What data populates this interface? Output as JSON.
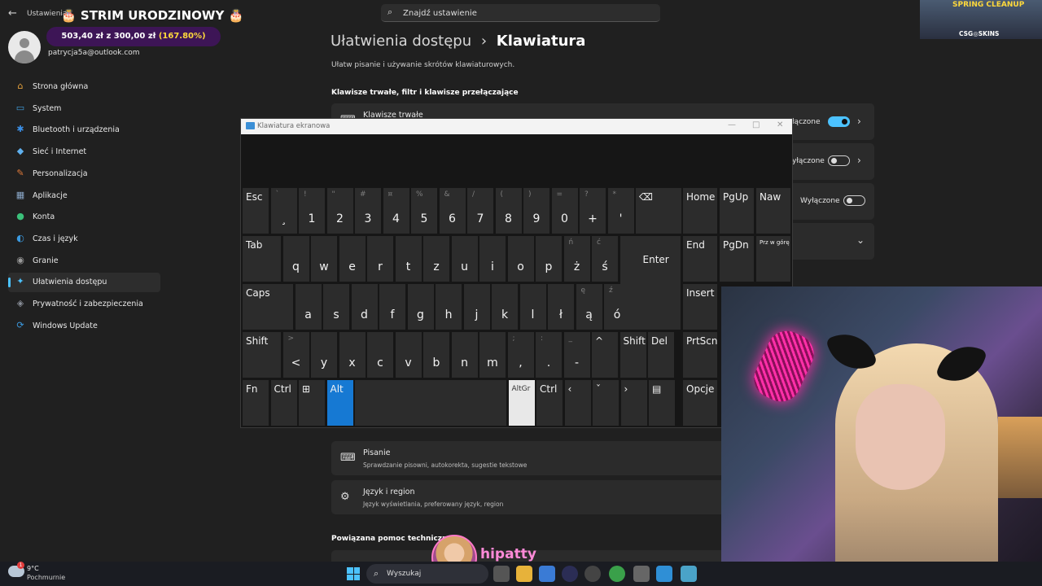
{
  "app": {
    "title": "Ustawienia",
    "back_glyph": "←"
  },
  "search": {
    "placeholder": "Znajdź ustawienie",
    "icon": "search-icon"
  },
  "account": {
    "email": "patrycja5a@outlook.com"
  },
  "stream_overlay": {
    "title": "🎂 STRIM URODZINOWY 🎂",
    "goal_text": "503,40 zł z 300,00 zł",
    "goal_percent": "(167.80%)",
    "banner_title": "SPRING CLEANUP",
    "banner_sub": "CSG◎SKINS",
    "streamer_name": "hipatty"
  },
  "sidebar": {
    "items": [
      {
        "label": "Strona główna",
        "icon": "home-icon",
        "glyph": "⌂",
        "color": "#e8a33c"
      },
      {
        "label": "System",
        "icon": "system-icon",
        "glyph": "▭",
        "color": "#3fa0e0"
      },
      {
        "label": "Bluetooth i urządzenia",
        "icon": "bluetooth-icon",
        "glyph": "✱",
        "color": "#3b8fe6"
      },
      {
        "label": "Sieć i Internet",
        "icon": "network-icon",
        "glyph": "◆",
        "color": "#5fb0ee"
      },
      {
        "label": "Personalizacja",
        "icon": "brush-icon",
        "glyph": "✎",
        "color": "#e07a3a"
      },
      {
        "label": "Aplikacje",
        "icon": "apps-icon",
        "glyph": "▦",
        "color": "#8aa7c8"
      },
      {
        "label": "Konta",
        "icon": "account-icon",
        "glyph": "●",
        "color": "#3bc07a"
      },
      {
        "label": "Czas i język",
        "icon": "globe-icon",
        "glyph": "◐",
        "color": "#3b9ae0"
      },
      {
        "label": "Granie",
        "icon": "gaming-icon",
        "glyph": "◉",
        "color": "#9a9a9a"
      },
      {
        "label": "Ułatwienia dostępu",
        "icon": "accessibility-icon",
        "glyph": "✦",
        "color": "#4cc2ff",
        "active": true
      },
      {
        "label": "Prywatność i zabezpieczenia",
        "icon": "shield-icon",
        "glyph": "◈",
        "color": "#8a8f99"
      },
      {
        "label": "Windows Update",
        "icon": "update-icon",
        "glyph": "⟳",
        "color": "#3b9ae0"
      }
    ]
  },
  "main": {
    "breadcrumb_parent": "Ułatwienia dostępu",
    "breadcrumb_sep": "›",
    "breadcrumb_current": "Klawiatura",
    "subtitle": "Ułatw pisanie i używanie skrótów klawiaturowych.",
    "section_title": "Klawisze trwałe, filtr i klawisze przełączające",
    "sticky_keys_label": "Klawisze trwałe",
    "toggle_rows": [
      {
        "state": "łączone",
        "on": true
      },
      {
        "state": "yłączone",
        "on": false
      },
      {
        "state": "Wyłączone",
        "on": false
      }
    ],
    "cards": [
      {
        "title": "Pisanie",
        "desc": "Sprawdzanie pisowni, autokorekta, sugestie tekstowe",
        "icon": "keyboard-icon"
      },
      {
        "title": "Język i region",
        "desc": "Język wyświetlania, preferowany język, region",
        "icon": "language-icon"
      }
    ],
    "related_title": "Powiązana pomoc techniczna"
  },
  "osk": {
    "title": "Klawiatura ekranowa",
    "row1": [
      {
        "label": "Esc"
      },
      {
        "top": "`",
        "main": "¸"
      },
      {
        "top": "!",
        "main": "1"
      },
      {
        "top": "\"",
        "main": "2"
      },
      {
        "top": "#",
        "main": "3"
      },
      {
        "top": "¤",
        "main": "4"
      },
      {
        "top": "%",
        "main": "5"
      },
      {
        "top": "&",
        "main": "6"
      },
      {
        "top": "/",
        "main": "7"
      },
      {
        "top": "(",
        "main": "8"
      },
      {
        "top": ")",
        "main": "9"
      },
      {
        "top": "=",
        "main": "0"
      },
      {
        "top": "?",
        "main": "+"
      },
      {
        "top": "*",
        "main": "'"
      },
      {
        "label": "⌫"
      }
    ],
    "row2": [
      {
        "label": "Tab"
      },
      {
        "main": "q"
      },
      {
        "main": "w"
      },
      {
        "main": "e"
      },
      {
        "main": "r"
      },
      {
        "main": "t"
      },
      {
        "main": "z"
      },
      {
        "main": "u"
      },
      {
        "main": "i"
      },
      {
        "main": "o"
      },
      {
        "main": "p"
      },
      {
        "top": "ń",
        "main": "ż"
      },
      {
        "top": "ć",
        "main": "ś"
      },
      {
        "label": "Enter"
      }
    ],
    "row3": [
      {
        "label": "Caps"
      },
      {
        "main": "a"
      },
      {
        "main": "s"
      },
      {
        "main": "d"
      },
      {
        "main": "f"
      },
      {
        "main": "g"
      },
      {
        "main": "h"
      },
      {
        "main": "j"
      },
      {
        "main": "k"
      },
      {
        "main": "l"
      },
      {
        "main": "ł"
      },
      {
        "top": "ę",
        "main": "ą"
      },
      {
        "top": "ź",
        "main": "ó"
      }
    ],
    "row4": [
      {
        "label": "Shift"
      },
      {
        "top": ">",
        "main": "<"
      },
      {
        "main": "y"
      },
      {
        "main": "x"
      },
      {
        "main": "c"
      },
      {
        "main": "v"
      },
      {
        "main": "b"
      },
      {
        "main": "n"
      },
      {
        "main": "m"
      },
      {
        "top": ";",
        "main": ","
      },
      {
        "top": ":",
        "main": "."
      },
      {
        "top": "_",
        "main": "-"
      },
      {
        "label": "^"
      },
      {
        "label": "Shift"
      },
      {
        "label": "Del"
      }
    ],
    "row5": [
      {
        "label": "Fn"
      },
      {
        "label": "Ctrl"
      },
      {
        "label": "⊞"
      },
      {
        "label": "Alt"
      },
      {
        "label": ""
      },
      {
        "label": "AltGr"
      },
      {
        "label": "Ctrl"
      },
      {
        "label": "‹"
      },
      {
        "label": "ˇ"
      },
      {
        "label": "›"
      },
      {
        "label": "▤"
      }
    ],
    "nav": {
      "home": "Home",
      "pgup": "PgUp",
      "naw": "Naw",
      "end": "End",
      "pgdn": "PgDn",
      "przwgore": "Prz w górę",
      "insert": "Insert",
      "prtscn": "PrtScn",
      "opcje": "Opcje"
    }
  },
  "taskbar": {
    "temp": "9°C",
    "condition": "Pochmurnie",
    "weather_badge": "1",
    "search_label": "Wyszukaj"
  }
}
